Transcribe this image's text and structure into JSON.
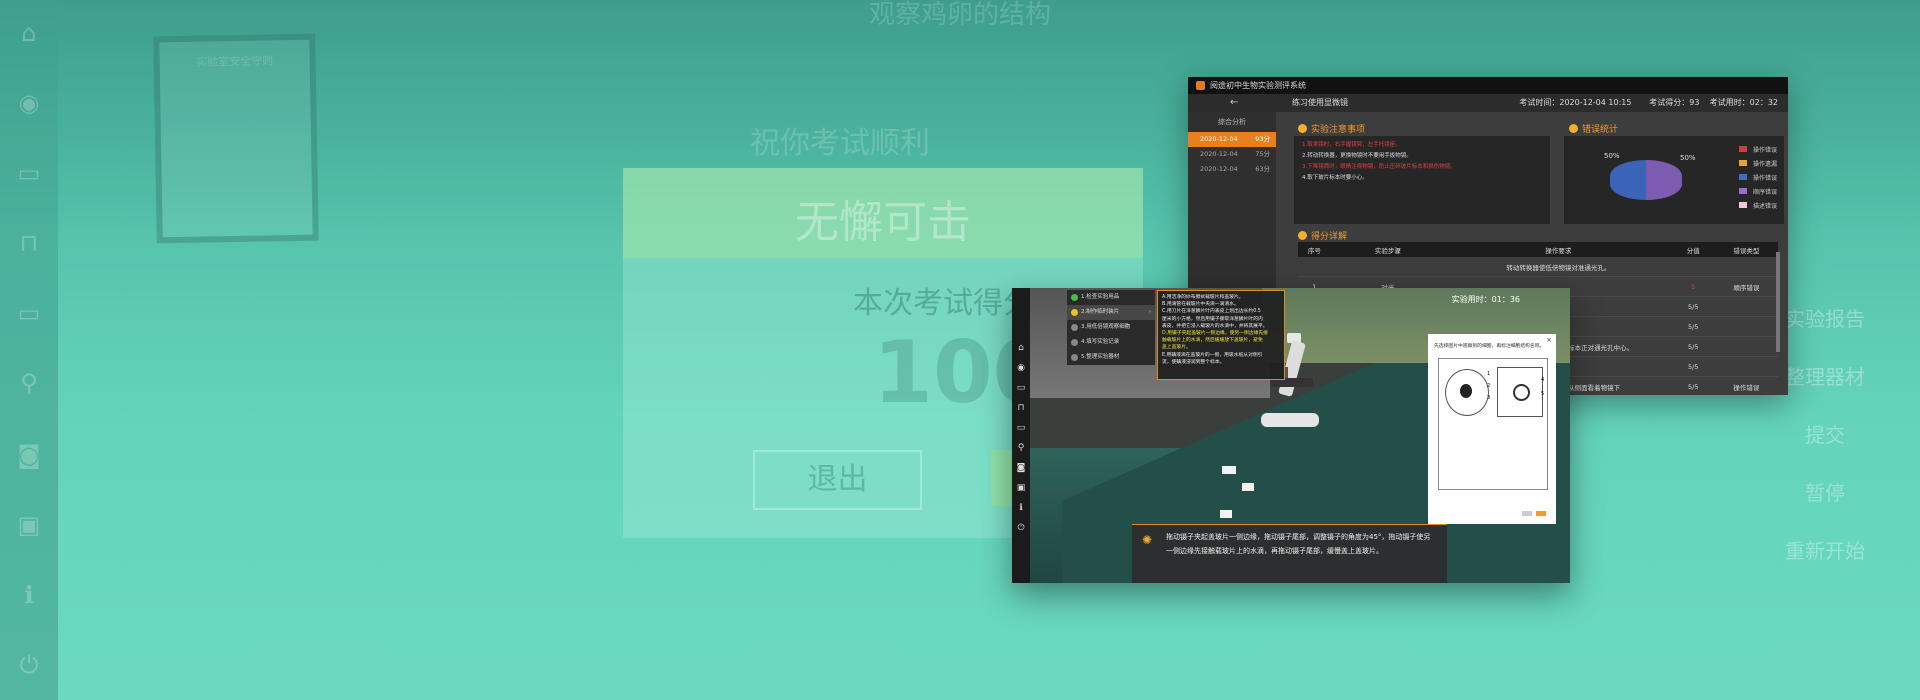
{
  "background": {
    "sidebar_icons": [
      "home-icon",
      "eye-icon",
      "box-icon",
      "lock-icon",
      "monitor-icon",
      "tool-icon",
      "camera-icon",
      "video-icon",
      "info-icon",
      "power-icon"
    ],
    "top_title": "观察鸡卵的结构",
    "poster_title": "实验室安全守则",
    "dialog_congrats": "祝你考试顺利",
    "dialog_title": "无懈可击",
    "dialog_score_label": "本次考试得分",
    "dialog_score": "100",
    "dialog_exit": "退出",
    "right_menu": [
      "实验报告",
      "整理器材",
      "提交",
      "暂停",
      "重新开始"
    ]
  },
  "report_window": {
    "app_title": "阅途初中生物实验测评系统",
    "subtitle": "练习使用显微镜",
    "exam_time": "考试时间：2020-12-04  10:15",
    "exam_score": "考试得分：93",
    "exam_duration": "考试用时：02：32",
    "analysis_header": "综合分析",
    "records": [
      {
        "date": "2020-12-04",
        "score": "93分"
      },
      {
        "date": "2020-12-04",
        "score": "75分"
      },
      {
        "date": "2020-12-04",
        "score": "63分"
      }
    ],
    "notes_title": "实验注意事项",
    "notes": [
      {
        "text": "1.取拿镜时，右手握镜臂，左手托镜座。",
        "red": true
      },
      {
        "text": "2.转动转换器，更换物镜时不要用手扳物镜。",
        "red": false
      },
      {
        "text": "3.下降镜筒时，眼睛注视物镜，防止压碎玻片标本和损伤物镜。",
        "red": true
      },
      {
        "text": "4.取下玻片标本时要小心。",
        "red": false
      }
    ],
    "error_title": "错误统计",
    "pie_labels": [
      "50%",
      "50%"
    ],
    "legend": [
      {
        "label": "操作错误",
        "color": "#d13b3b"
      },
      {
        "label": "操作遗漏",
        "color": "#e8a23a"
      },
      {
        "label": "操作错误",
        "color": "#3f6ec7"
      },
      {
        "label": "顺序错误",
        "color": "#9b6bd3"
      },
      {
        "label": "描述错误",
        "color": "#f3c7d6"
      }
    ],
    "detail_title": "得分详解",
    "table_headers": [
      "序号",
      "实验步骤",
      "操作要求",
      "分值",
      "错误类型"
    ],
    "table_rows": [
      {
        "no": "",
        "step": "",
        "req": "转动转换器使低倍物镜对准通光孔。",
        "score": "",
        "err": ""
      },
      {
        "no": "1",
        "step": "对光",
        "req": "",
        "score": "5",
        "err": "顺序错误"
      },
      {
        "no": "",
        "step": "",
        "req": "",
        "score": "5/5",
        "err": ""
      },
      {
        "no": "",
        "step": "",
        "req": "",
        "score": "5/5",
        "err": ""
      },
      {
        "no": "",
        "step": "",
        "req": "把玻片标本放在载物台上，使标本正对通光孔中心。",
        "score": "5/5",
        "err": ""
      },
      {
        "no": "",
        "step": "",
        "req": "",
        "score": "5/5",
        "err": ""
      },
      {
        "no": "",
        "step": "",
        "req": "调节粗准焦螺旋，此时要从侧面看着物镜下",
        "score": "5/5",
        "err": "操作错误"
      }
    ]
  },
  "scene_window": {
    "timer": "实验用时：01：36",
    "steps": [
      {
        "label": "1.检查实验用品",
        "state": "done"
      },
      {
        "label": "2.制作临时装片",
        "state": "sel"
      },
      {
        "label": "3.用低倍镜观察细胞",
        "state": ""
      },
      {
        "label": "4.填写实验记录",
        "state": ""
      },
      {
        "label": "5.整理实验器材",
        "state": ""
      }
    ],
    "detail_lines": [
      {
        "text": "A.用洁净的纱布擦拭载玻片和盖玻片。",
        "y": false
      },
      {
        "text": "B.用滴管在载玻片中央滴一滴清水。",
        "y": false
      },
      {
        "text": "C.用刀片在洋葱鳞片叶内表皮上划出边长约0.5",
        "y": false
      },
      {
        "text": "厘米的小方格，然后用镊子撕取洋葱鳞片叶的内",
        "y": false
      },
      {
        "text": "表皮，并把它浸入载玻片的水滴中，并将其展平。",
        "y": false
      },
      {
        "text": "D.用镊子夹起盖玻片一侧边缘，使另一侧边缘先接",
        "y": true
      },
      {
        "text": "触载玻片上的水滴，然后缓缓放下盖玻片，避免",
        "y": true
      },
      {
        "text": "盖上盖玻片。",
        "y": true
      },
      {
        "text": "E.用碘液滴在盖玻片的一侧，用吸水纸从对侧引",
        "y": false
      },
      {
        "text": "流，使碘液浸润到整个标本。",
        "y": false
      }
    ],
    "quiz_question": "先选择图片中观察到的细胞，再标注细胞结构名称。",
    "quiz_nums": [
      "1",
      "2",
      "3",
      "4",
      "5"
    ],
    "hint": "拖动镊子夹起盖玻片一侧边缘，拖动镊子尾部，调整镊子的角度为45°，拖动镊子使另一侧边缘先接触载玻片上的水滴，再拖动镊子尾部，缓慢盖上盖玻片。",
    "left_icons": [
      "home-icon",
      "eye-icon",
      "box-icon",
      "lock-icon",
      "monitor-icon",
      "tool-icon",
      "camera-icon",
      "video-icon",
      "info-icon",
      "power-icon"
    ]
  }
}
